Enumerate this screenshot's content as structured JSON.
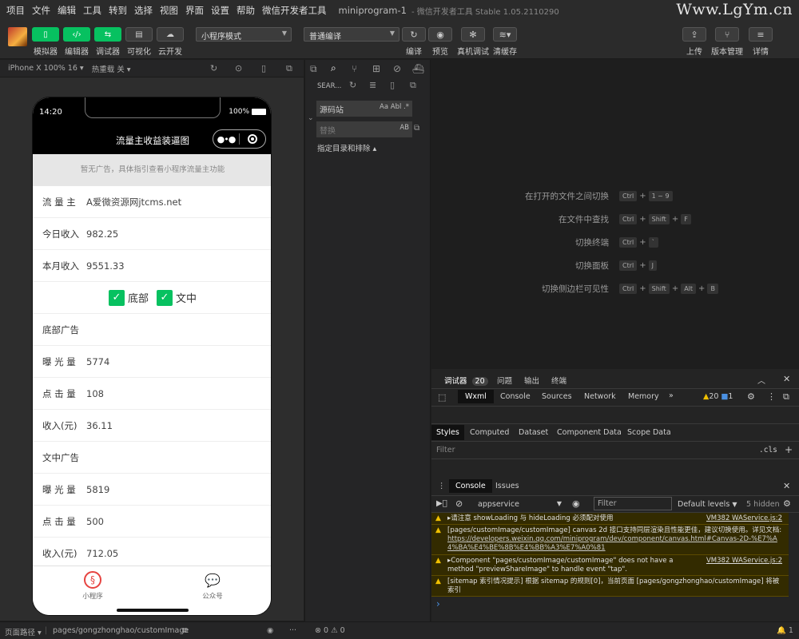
{
  "menu": {
    "items": [
      "项目",
      "文件",
      "编辑",
      "工具",
      "转到",
      "选择",
      "视图",
      "界面",
      "设置",
      "帮助",
      "微信开发者工具"
    ],
    "window_title": "miniprogram-1",
    "window_subtitle": "- 微信开发者工具 Stable 1.05.2110290"
  },
  "watermark": "Www.LgYm.cn",
  "toolbar": {
    "simulator": "模拟器",
    "editor": "编辑器",
    "debugger": "调试器",
    "visual": "可视化",
    "cloud": "云开发",
    "mode_select": "小程序模式",
    "compile_select": "普通编译",
    "compile": "编译",
    "preview": "预览",
    "remote_debug": "真机调试",
    "clear_cache": "清缓存",
    "upload": "上传",
    "version": "版本管理",
    "details": "详情"
  },
  "simbar": {
    "device": "iPhone X 100% 16",
    "hot_reload": "热重载 关"
  },
  "phone": {
    "time": "14:20",
    "battery": "100%",
    "nav_title": "流量主收益装逼图",
    "ad_banner": "暂无广告，具体指引查看小程序流量主功能",
    "rows": [
      {
        "label": "流 量 主",
        "value": "A爱微资源网jtcms.net"
      },
      {
        "label": "今日收入",
        "value": "982.25"
      },
      {
        "label": "本月收入",
        "value": "9551.33"
      }
    ],
    "check_bottom": "底部",
    "check_inline": "文中",
    "section_bottom": "底部广告",
    "bottom_rows": [
      {
        "label": "曝 光 量",
        "value": "5774"
      },
      {
        "label": "点 击 量",
        "value": "108"
      },
      {
        "label": "收入(元)",
        "value": "36.11"
      }
    ],
    "section_inline": "文中广告",
    "inline_rows": [
      {
        "label": "曝 光 量",
        "value": "5819"
      },
      {
        "label": "点 击 量",
        "value": "500"
      },
      {
        "label": "收入(元)",
        "value": "712.05"
      }
    ],
    "tab_miniprogram": "小程序",
    "tab_official": "公众号"
  },
  "explorer": {
    "search_tab": "SEAR...",
    "search_value": "源码站",
    "search_opts": "Aa  Abl  .*",
    "replace_placeholder": "替换",
    "replace_opt": "AB",
    "include_exclude": "指定目录和排除"
  },
  "shortcuts": [
    {
      "label": "在打开的文件之间切换",
      "keys": [
        "Ctrl",
        "+",
        "1 ~ 9"
      ]
    },
    {
      "label": "在文件中查找",
      "keys": [
        "Ctrl",
        "+",
        "Shift",
        "+",
        "F"
      ]
    },
    {
      "label": "切换终端",
      "keys": [
        "Ctrl",
        "+",
        "`"
      ]
    },
    {
      "label": "切换面板",
      "keys": [
        "Ctrl",
        "+",
        "J"
      ]
    },
    {
      "label": "切换侧边栏可见性",
      "keys": [
        "Ctrl",
        "+",
        "Shift",
        "+",
        "Alt",
        "+",
        "B"
      ]
    }
  ],
  "devtools": {
    "tabs": {
      "debugger": "调试器",
      "debugger_count": "20",
      "problems": "问题",
      "output": "输出",
      "terminal": "终端"
    },
    "inner_tabs": [
      "Wxml",
      "Console",
      "Sources",
      "Network",
      "Memory"
    ],
    "warn_count": "20",
    "info_count": "1",
    "style_tabs": [
      "Styles",
      "Computed",
      "Dataset",
      "Component Data",
      "Scope Data"
    ],
    "filter_placeholder": "Filter",
    "cls": ".cls",
    "console_tabs": [
      "Console",
      "Issues"
    ],
    "context": "appservice",
    "console_filter": "Filter",
    "levels": "Default levels",
    "hidden": "5 hidden",
    "messages": [
      {
        "text": "▸请注意 showLoading 与 hideLoading 必须配对使用",
        "src": "VM382 WAService.js:2"
      },
      {
        "text": "[pages/customImage/customImage] canvas 2d 接口支持同层渲染且性能更佳，建议切换使用。详见文档: ",
        "link": "https://developers.weixin.qq.com/miniprogram/dev/component/canvas.html#Canvas-2D-%E7%A4%BA%E4%BE%8B%E4%BB%A3%E7%A0%81"
      },
      {
        "text": "▸Component \"pages/customImage/customImage\" does not have a method \"previewShareImage\" to handle event \"tap\".",
        "src": "VM382 WAService.js:2"
      },
      {
        "text": "[sitemap 索引情况提示] 根据 sitemap 的规则[0]，当前页面 [pages/gongzhonghao/customImage] 将被索引"
      }
    ],
    "prompt": "›"
  },
  "status": {
    "path_label": "页面路径",
    "path": "pages/gongzhonghao/customImage",
    "errors": "0",
    "warnings": "0",
    "bell_count": "1"
  }
}
